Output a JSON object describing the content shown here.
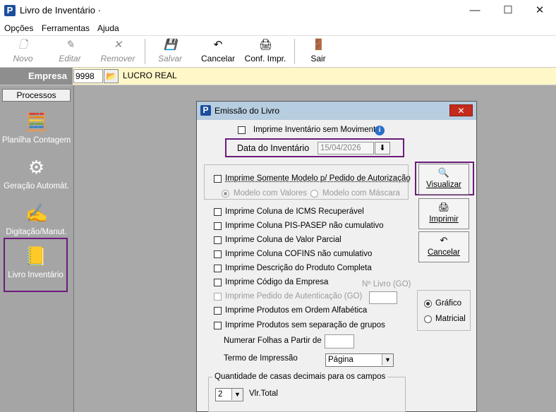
{
  "window": {
    "title": "Livro de Inventário ·",
    "minimize_glyph": "—",
    "maximize_glyph": "☐",
    "close_glyph": "✕"
  },
  "menu": [
    "Opções",
    "Ferramentas",
    "Ajuda"
  ],
  "toolbar": {
    "novo": "Novo",
    "editar": "Editar",
    "remover": "Remover",
    "salvar": "Salvar",
    "cancelar": "Cancelar",
    "conf_impr": "Conf. Impr.",
    "sair": "Sair",
    "icons": {
      "novo": "🗋",
      "editar": "✎",
      "remover": "✕",
      "salvar": "💾",
      "cancelar": "↶",
      "conf_impr": "🖨",
      "sair": "🚪"
    }
  },
  "empresa": {
    "label": "Empresa",
    "code": "9998",
    "name": "LUCRO REAL",
    "lookup_glyph": "📂"
  },
  "sidebar": {
    "header": "Processos",
    "items": [
      {
        "label": "Planilha Contagem",
        "icon": "🧮"
      },
      {
        "label": "Geração Automát.",
        "icon": "⚙"
      },
      {
        "label": "Digitação/Manut.",
        "icon": "✍"
      },
      {
        "label": "Livro Inventário",
        "icon": "📒"
      }
    ]
  },
  "dialog": {
    "title": "Emissão do Livro",
    "close_glyph": "✕",
    "imprime_sem_movimento": "Imprime Inventário sem Movimento",
    "info_glyph": "i",
    "data_label": "Data do Inventário",
    "data_value": "15/04/2026",
    "date_btn_glyph": "⬇",
    "somente_modelo": "Imprime Somente Modelo p/ Pedido de Autorização",
    "modelo_valores": "Modelo com Valores",
    "modelo_mascara": "Modelo com Máscara",
    "options": [
      {
        "label": "Imprime Coluna de ICMS Recuperável",
        "disabled": false
      },
      {
        "label": "Imprime Coluna PIS-PASEP não cumulativo",
        "disabled": false
      },
      {
        "label": "Imprime Coluna de Valor Parcial",
        "disabled": false
      },
      {
        "label": "Imprime Coluna COFINS não cumulativo",
        "disabled": false
      },
      {
        "label": "Imprime Descrição do Produto Completa",
        "disabled": false
      },
      {
        "label": "Imprime Código da Empresa",
        "disabled": false
      },
      {
        "label": "Imprime Pedido de Autenticação (GO)",
        "disabled": true
      },
      {
        "label": "Imprime Produtos em Ordem Alfabética",
        "disabled": false
      },
      {
        "label": "Imprime Produtos sem separação de grupos",
        "disabled": false
      }
    ],
    "nro_livro_label": "Nº Livro (GO)",
    "numerar_label": "Numerar Folhas a Partir de :",
    "termo_label": "Termo de Impressão",
    "termo_value": "Página",
    "decimais_label": "Quantidade de casas decimais para os campos",
    "decimais_value": "2",
    "vlr_total_label": "Vlr.Total",
    "buttons": {
      "visualizar": "Visualizar",
      "imprimir": "Imprimir",
      "cancelar": "Cancelar",
      "icons": {
        "visualizar": "🔍",
        "imprimir": "🖨",
        "cancelar": "↶"
      }
    },
    "output_grafico": "Gráfico",
    "output_matricial": "Matricial",
    "combo_arrow": "▼"
  }
}
